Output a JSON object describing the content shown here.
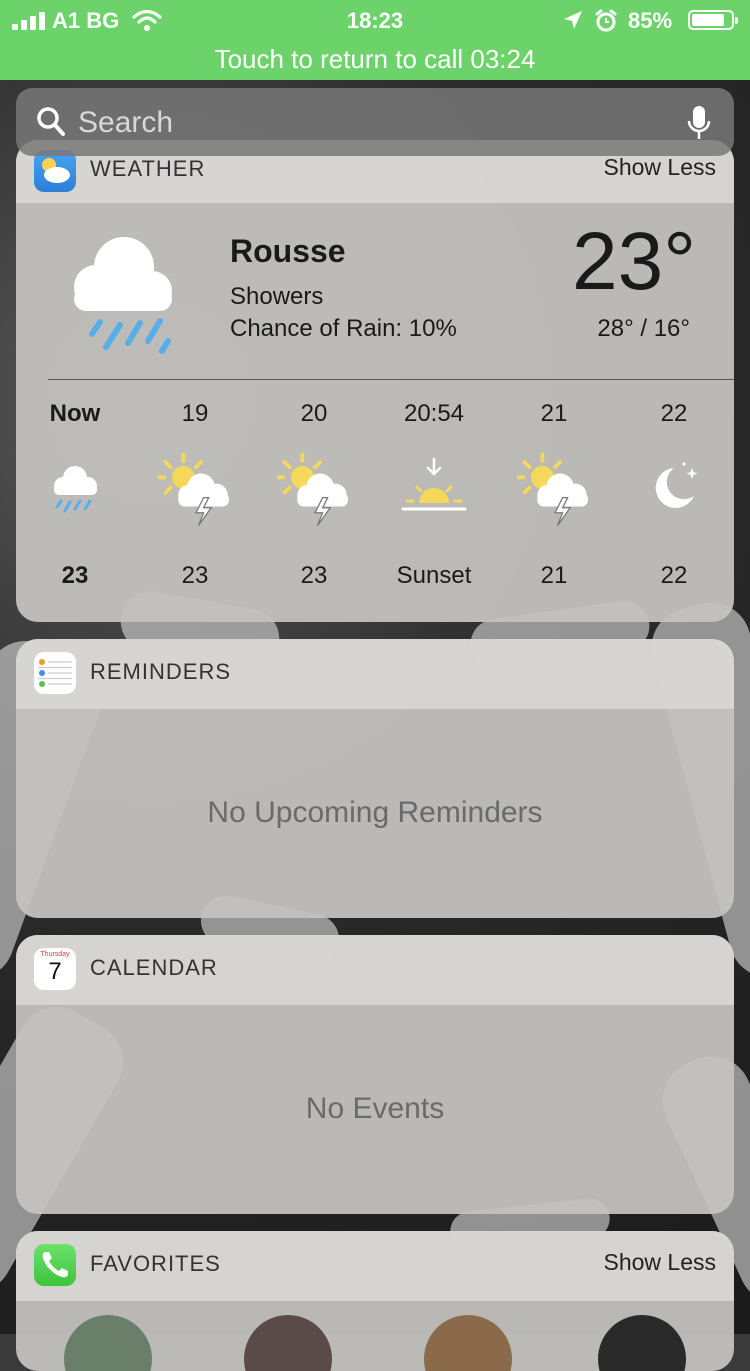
{
  "status": {
    "carrier": "A1 BG",
    "time": "18:23",
    "battery_percent": "85%",
    "battery_level": 0.85,
    "call_banner": "Touch to return to call 03:24"
  },
  "search": {
    "placeholder": "Search"
  },
  "weather": {
    "header": "WEATHER",
    "toggle": "Show Less",
    "city": "Rousse",
    "condition": "Showers",
    "rain_chance": "Chance of Rain: 10%",
    "temperature": "23°",
    "high_low": "28° / 16°",
    "hourly": [
      {
        "label": "Now",
        "icon": "rain-cloud-icon",
        "temp": "23"
      },
      {
        "label": "19",
        "icon": "sun-thunderstorm-icon",
        "temp": "23"
      },
      {
        "label": "20",
        "icon": "sun-thunderstorm-icon",
        "temp": "23"
      },
      {
        "label": "20:54",
        "icon": "sunset-icon",
        "temp": "Sunset"
      },
      {
        "label": "21",
        "icon": "sun-thunderstorm-icon",
        "temp": "21"
      },
      {
        "label": "22",
        "icon": "moon-stars-icon",
        "temp": "22"
      }
    ]
  },
  "reminders": {
    "header": "REMINDERS",
    "empty": "No Upcoming Reminders"
  },
  "calendar": {
    "header": "CALENDAR",
    "icon_weekday": "Thursday",
    "icon_day": "7",
    "empty": "No Events"
  },
  "favorites": {
    "header": "FAVORITES",
    "toggle": "Show Less"
  },
  "colors": {
    "statusbar": "#6cd36a",
    "widget_bg": "#c4c2bf",
    "rain_blue": "#5aaee8",
    "sun_yellow": "#f5d85a"
  }
}
